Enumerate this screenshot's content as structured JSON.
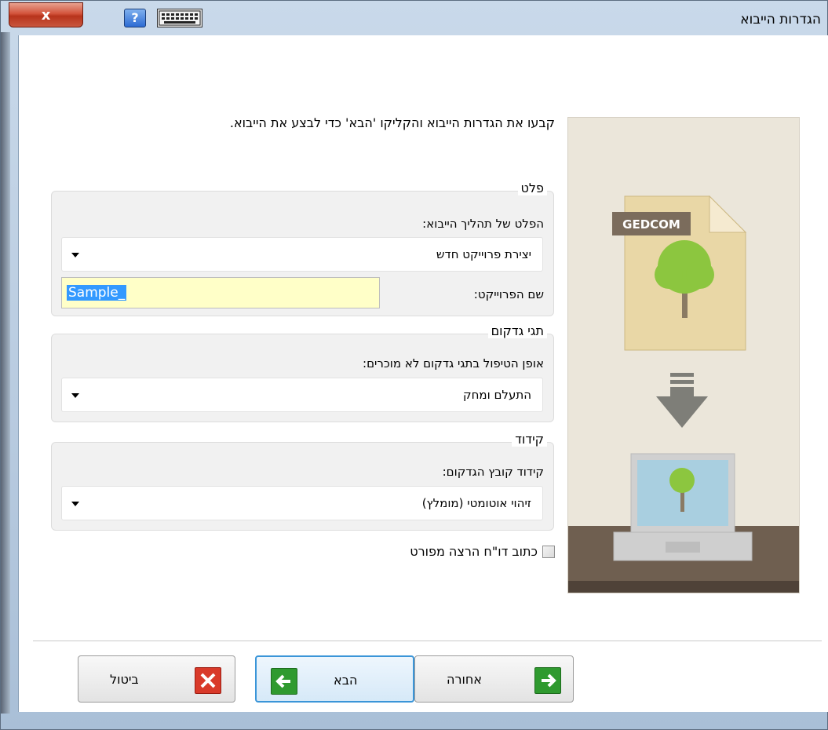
{
  "window": {
    "title": "הגדרות הייבוא",
    "close_label": "x",
    "help_label": "?"
  },
  "intro_text": "קבעו את הגדרות הייבוא והקליקו 'הבא' כדי לבצע את הייבוא.",
  "output_group": {
    "title": "פלט",
    "process_label": "הפלט של תהליך הייבוא:",
    "process_value": "יצירת פרוייקט חדש",
    "project_name_label": "שם הפרוייקט:",
    "project_name_value": "Sample_"
  },
  "tags_group": {
    "title": "תגי גדקום",
    "handling_label": "אופן הטיפול בתגי גדקום לא מוכרים:",
    "handling_value": "התעלם ומחק"
  },
  "encoding_group": {
    "title": "קידוד",
    "encoding_label": "קידוד קובץ הגדקום:",
    "encoding_value": "זיהוי אוטומטי (מומלץ)"
  },
  "report_checkbox": {
    "label": "כתוב דו\"ח הרצה מפורט",
    "checked": false
  },
  "illustration": {
    "badge": "GEDCOM"
  },
  "buttons": {
    "back": "אחורה",
    "next": "הבא",
    "cancel": "ביטול"
  },
  "colors": {
    "input_highlight": "#ffffc8",
    "selection": "#3399ff",
    "next_icon": "#2f9a2f",
    "cancel_icon": "#d93a2a"
  }
}
